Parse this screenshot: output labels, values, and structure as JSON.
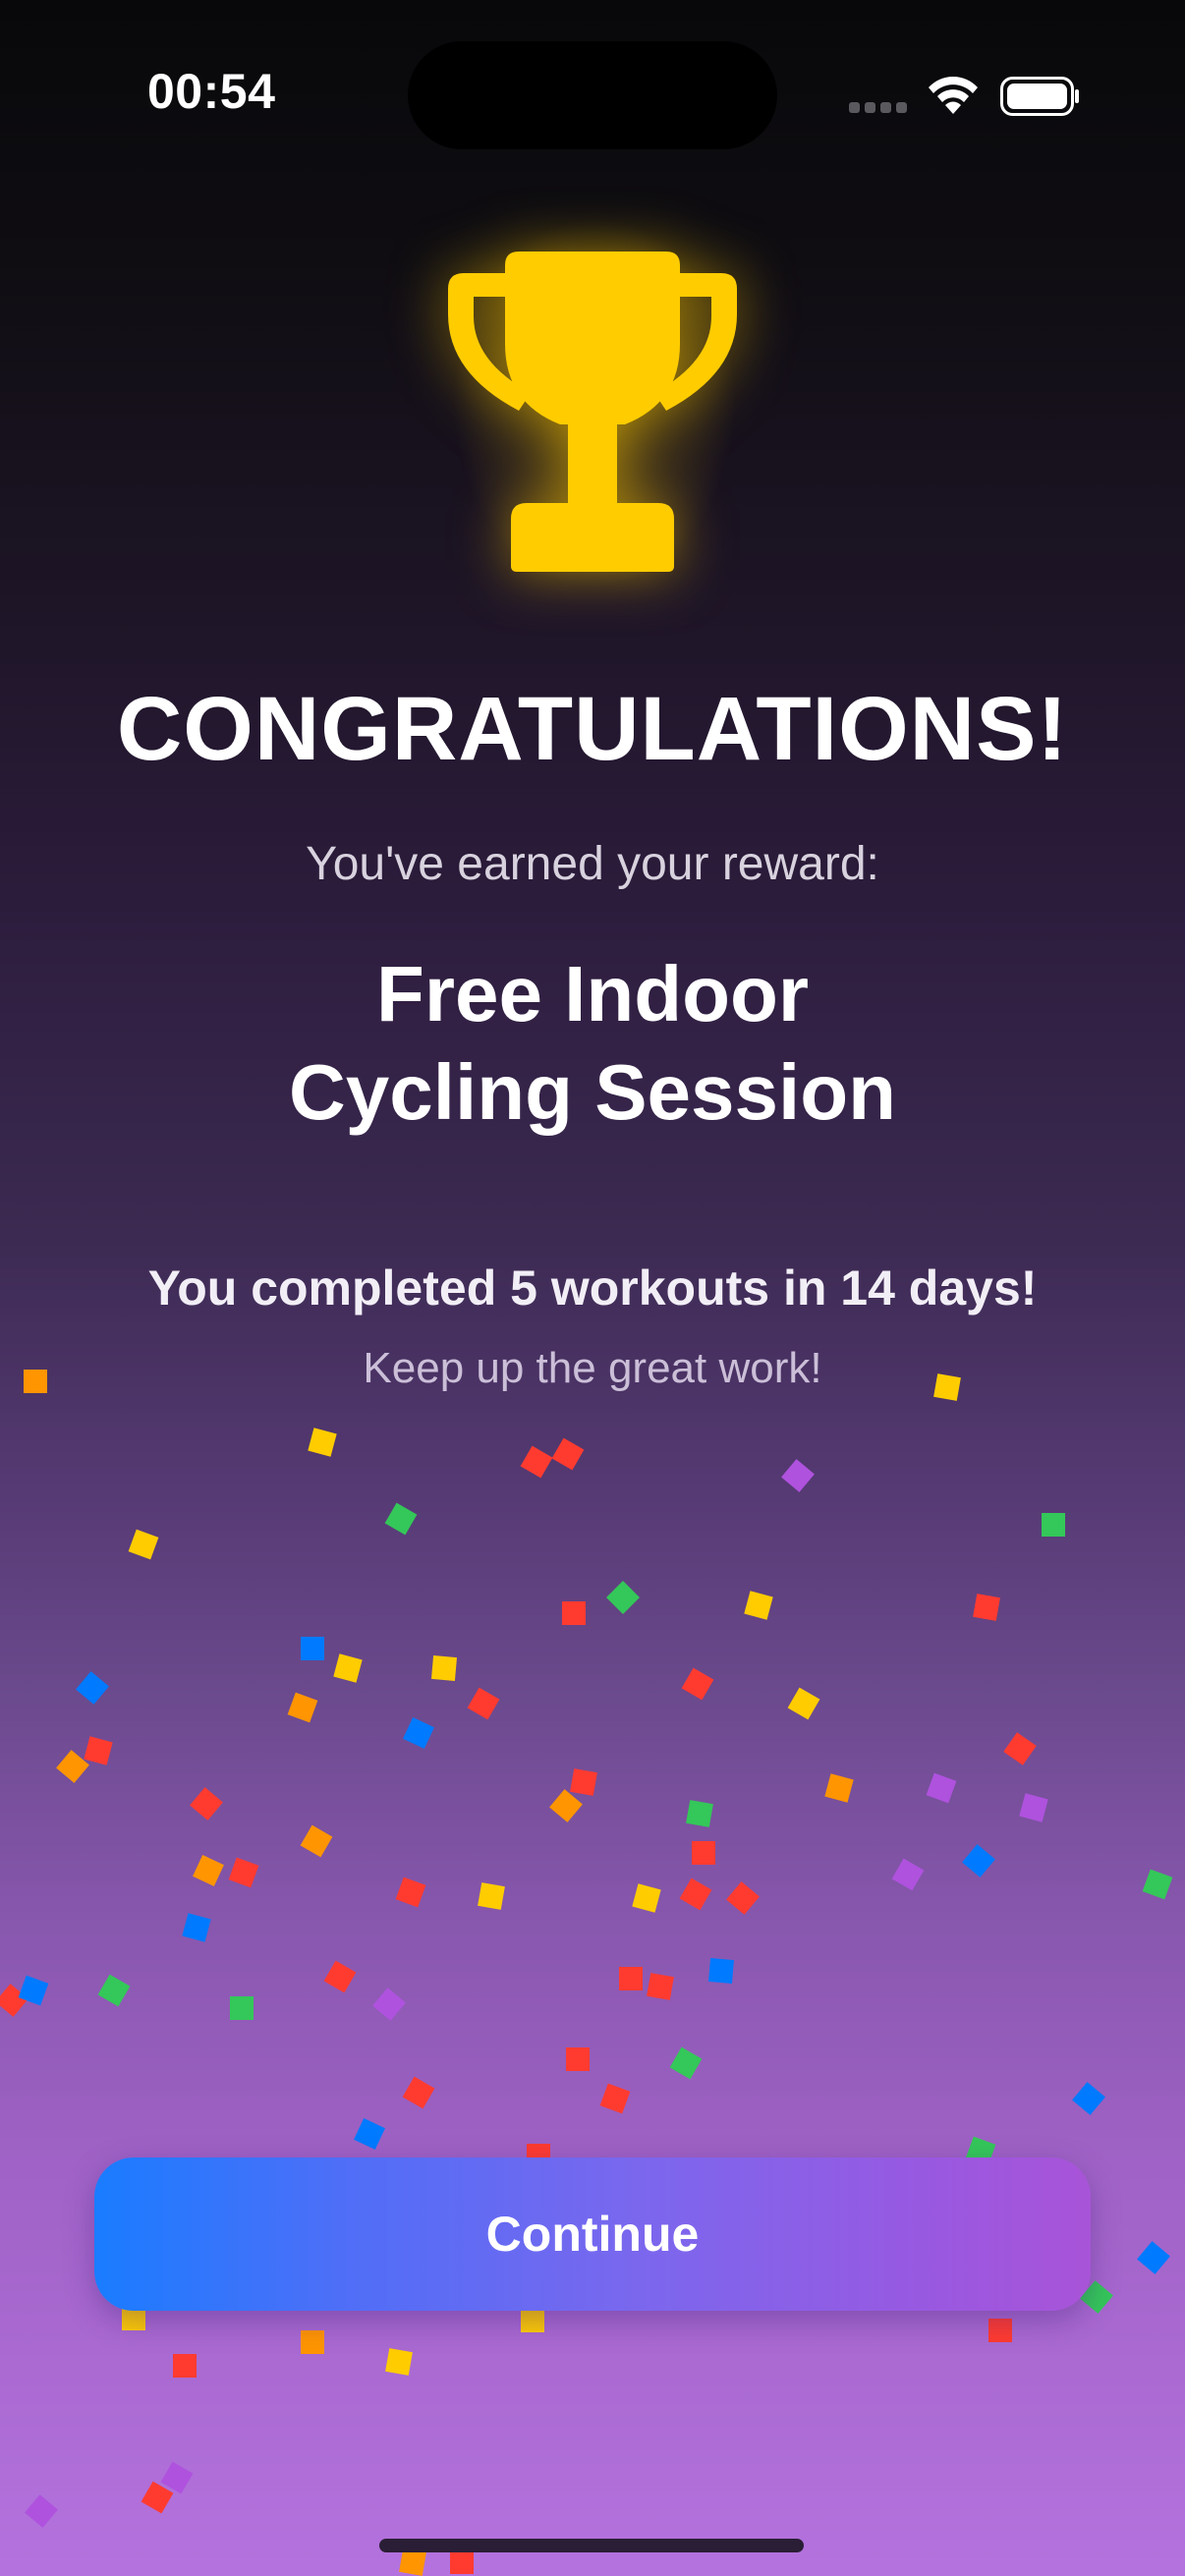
{
  "status_bar": {
    "time": "00:54",
    "icons": [
      "cellular-signal-icon",
      "wifi-icon",
      "battery-icon"
    ]
  },
  "hero": {
    "icon": "trophy-icon",
    "icon_color": "#FFCC00"
  },
  "title": "CONGRATULATIONS!",
  "subtitle": "You've earned your reward:",
  "reward": {
    "line1": "Free Indoor",
    "line2": "Cycling Session"
  },
  "stats_text": "You completed 5 workouts in 14 days!",
  "encouragement": "Keep up the great work!",
  "continue_button": {
    "label": "Continue",
    "gradient_start": "#1A7CFF",
    "gradient_end": "#A854D8"
  },
  "confetti_colors": [
    "#FF3B30",
    "#FF9500",
    "#FFCC00",
    "#34C759",
    "#007AFF",
    "#AF52DE",
    "#FF2D55"
  ]
}
